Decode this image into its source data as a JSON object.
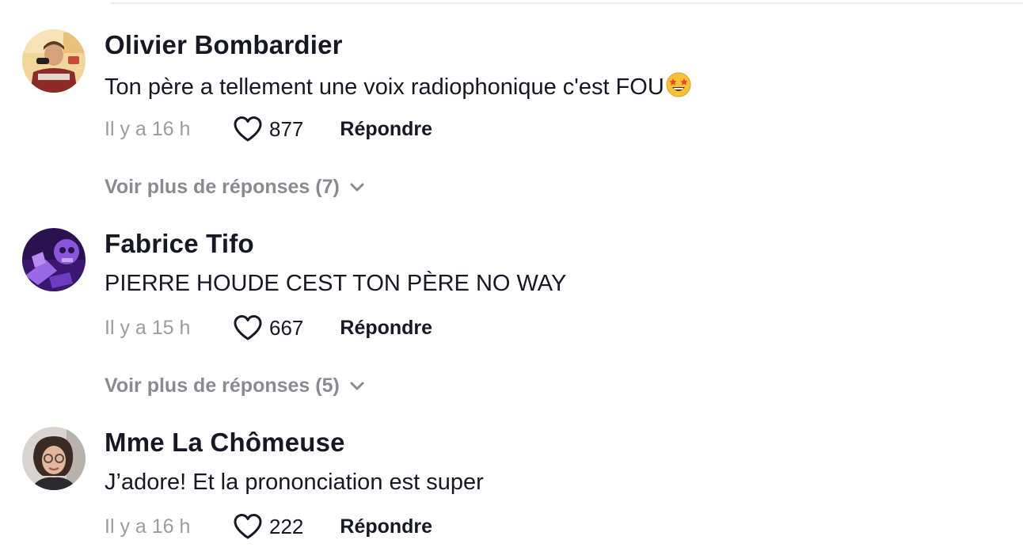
{
  "comments": [
    {
      "username": "Olivier Bombardier",
      "text": "Ton père a tellement une voix radiophonique c'est FOU",
      "emoji_icon": "star-struck-emoji",
      "time": "Il y a 16 h",
      "likes": "877",
      "reply_label": "Répondre",
      "more_replies": "Voir plus de réponses (7)"
    },
    {
      "username": "Fabrice Tifo",
      "text": "PIERRE HOUDE CEST TON PÈRE NO WAY",
      "time": "Il y a 15 h",
      "likes": "667",
      "reply_label": "Répondre",
      "more_replies": "Voir plus de réponses (5)"
    },
    {
      "username": "Mme La Chômeuse",
      "text": "J’adore! Et la prononciation est super",
      "time": "Il y a 16 h",
      "likes": "222",
      "reply_label": "Répondre"
    }
  ],
  "icons": {
    "like": "heart-outline-icon",
    "expand": "chevron-down-icon"
  },
  "colors": {
    "primary_text": "#161823",
    "secondary_text": "#9b9ba1",
    "more_text": "#8a8b91",
    "emoji_yellow": "#f7c137"
  }
}
